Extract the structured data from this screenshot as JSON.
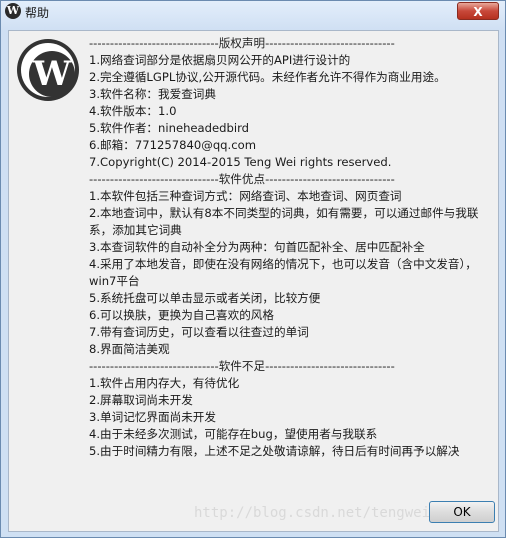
{
  "window": {
    "title": "帮助",
    "close_label": "X"
  },
  "logo": {
    "letter": "W"
  },
  "sections": [
    {
      "header": "-------------------------------版权声明-------------------------------",
      "lines": [
        "1.网络查词部分是依据扇贝网公开的API进行设计的",
        "2.完全遵循LGPL协议,公开源代码。未经作者允许不得作为商业用途。",
        "3.软件名称：我爱查词典",
        "4.软件版本：1.0",
        "5.软件作者：nineheadedbird",
        "6.邮箱：771257840@qq.com",
        "7.Copyright(C) 2014-2015 Teng Wei rights reserved."
      ]
    },
    {
      "header": "-------------------------------软件优点-------------------------------",
      "lines": [
        "1.本软件包括三种查词方式：网络查词、本地查词、网页查词",
        "2.本地查词中，默认有8本不同类型的词典，如有需要，可以通过邮件与我联系，添加其它词典",
        "3.本查词软件的自动补全分为两种：句首匹配补全、居中匹配补全",
        "4.采用了本地发音，即使在没有网络的情况下，也可以发音（含中文发音），win7平台",
        "5.系统托盘可以单击显示或者关闭，比较方便",
        "6.可以换肤，更换为自己喜欢的风格",
        "7.带有查词历史，可以查看以往查过的单词",
        "8.界面简洁美观"
      ]
    },
    {
      "header": "-------------------------------软件不足-------------------------------",
      "lines": [
        "1.软件占用内存大，有待优化",
        "2.屏幕取词尚未开发",
        "3.单词记忆界面尚未开发",
        "4.由于未经多次测试，可能存在bug，望使用者与我联系",
        "5.由于时间精力有限，上述不足之处敬请谅解，待日后有时间再予以解决"
      ]
    }
  ],
  "ok_label": "OK",
  "watermark": "http://blog.csdn.net/tengweitw"
}
